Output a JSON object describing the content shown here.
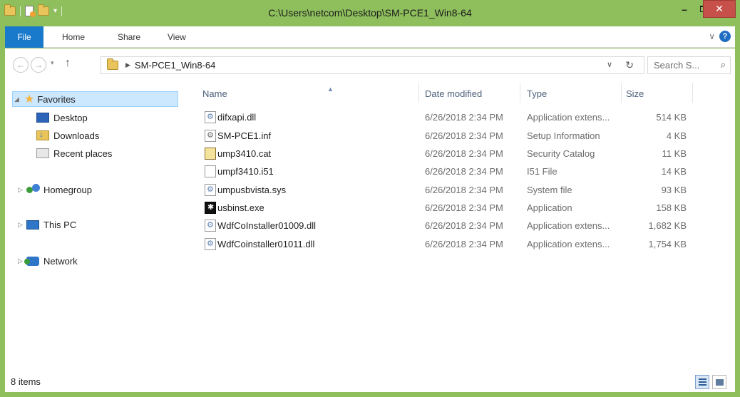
{
  "window": {
    "title": "C:\\Users\\netcom\\Desktop\\SM-PCE1_Win8-64",
    "minimize_label": "–",
    "close_label": "✕"
  },
  "ribbon": {
    "tabs": [
      {
        "label": "File"
      },
      {
        "label": "Home"
      },
      {
        "label": "Share"
      },
      {
        "label": "View"
      }
    ],
    "help_label": "?"
  },
  "nav": {
    "address_crumb": "SM-PCE1_Win8-64",
    "search_placeholder": "Search S..."
  },
  "sidebar": {
    "favorites": "Favorites",
    "items": [
      {
        "label": "Desktop"
      },
      {
        "label": "Downloads"
      },
      {
        "label": "Recent places"
      }
    ],
    "homegroup": "Homegroup",
    "this_pc": "This PC",
    "network": "Network"
  },
  "columns": {
    "name": "Name",
    "date": "Date modified",
    "type": "Type",
    "size": "Size"
  },
  "files": [
    {
      "name": "difxapi.dll",
      "date": "6/26/2018 2:34 PM",
      "type": "Application extens...",
      "size": "514 KB",
      "icon": "dll-icon"
    },
    {
      "name": "SM-PCE1.inf",
      "date": "6/26/2018 2:34 PM",
      "type": "Setup Information",
      "size": "4 KB",
      "icon": "inf-icon"
    },
    {
      "name": "ump3410.cat",
      "date": "6/26/2018 2:34 PM",
      "type": "Security Catalog",
      "size": "11 KB",
      "icon": "cat-icon"
    },
    {
      "name": "umpf3410.i51",
      "date": "6/26/2018 2:34 PM",
      "type": "I51 File",
      "size": "14 KB",
      "icon": "file-icon"
    },
    {
      "name": "umpusbvista.sys",
      "date": "6/26/2018 2:34 PM",
      "type": "System file",
      "size": "93 KB",
      "icon": "sys-icon"
    },
    {
      "name": "usbinst.exe",
      "date": "6/26/2018 2:34 PM",
      "type": "Application",
      "size": "158 KB",
      "icon": "exe-icon"
    },
    {
      "name": "WdfCoInstaller01009.dll",
      "date": "6/26/2018 2:34 PM",
      "type": "Application extens...",
      "size": "1,682 KB",
      "icon": "dll-icon"
    },
    {
      "name": "WdfCoinstaller01011.dll",
      "date": "6/26/2018 2:34 PM",
      "type": "Application extens...",
      "size": "1,754 KB",
      "icon": "dll-icon"
    }
  ],
  "status": {
    "item_count": "8 items"
  }
}
